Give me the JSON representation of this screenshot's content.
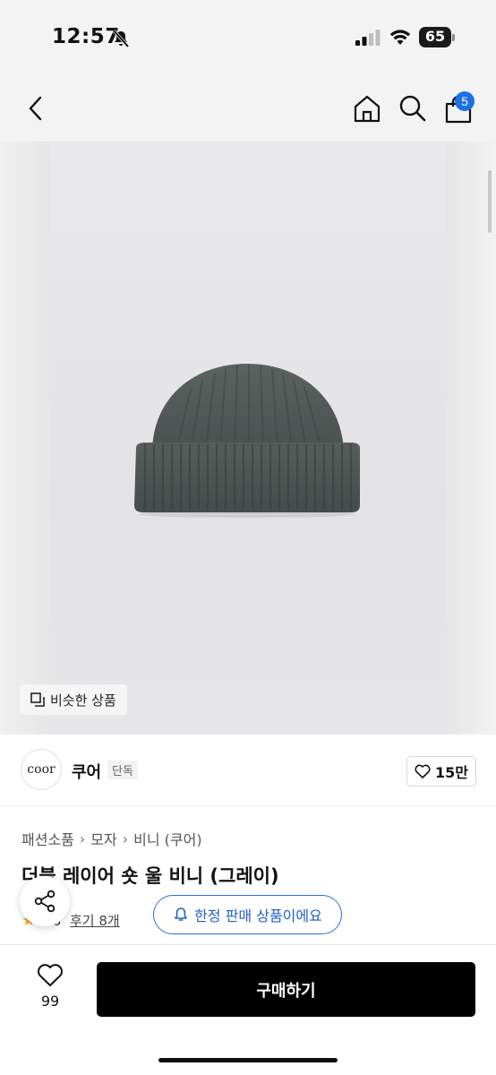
{
  "status_bar": {
    "time": "12:57",
    "battery": "65",
    "icons": [
      "bell-slash-icon",
      "signal-icon",
      "wifi-icon",
      "battery-icon"
    ]
  },
  "nav": {
    "back_icon": "chevron-left-icon",
    "home_icon": "home-icon",
    "search_icon": "search-icon",
    "cart_icon": "shopping-bag-icon",
    "cart_badge": "5"
  },
  "hero": {
    "similar_label": "비슷한 상품",
    "similar_icon": "copy-icon"
  },
  "brand": {
    "logo_text": "coor",
    "name": "쿠어",
    "tag": "단독",
    "likes": "15만",
    "like_icon": "heart-icon"
  },
  "breadcrumb": {
    "items": [
      "패션소품",
      "모자",
      "비니 (쿠어)"
    ]
  },
  "product": {
    "title": "더블 레이어 숏 울 비니 (그레이)",
    "rating": "4.6",
    "reviews": "후기 8개",
    "limited_label": "한정 판매 상품이에요",
    "limited_icon": "bell-icon",
    "share_icon": "share-icon"
  },
  "bottom": {
    "wish_count": "99",
    "wish_icon": "heart-icon",
    "buy_label": "구매하기"
  },
  "colors": {
    "accent": "#1f6fe5",
    "buy_button": "#000000",
    "beanie": "#4e5553"
  }
}
